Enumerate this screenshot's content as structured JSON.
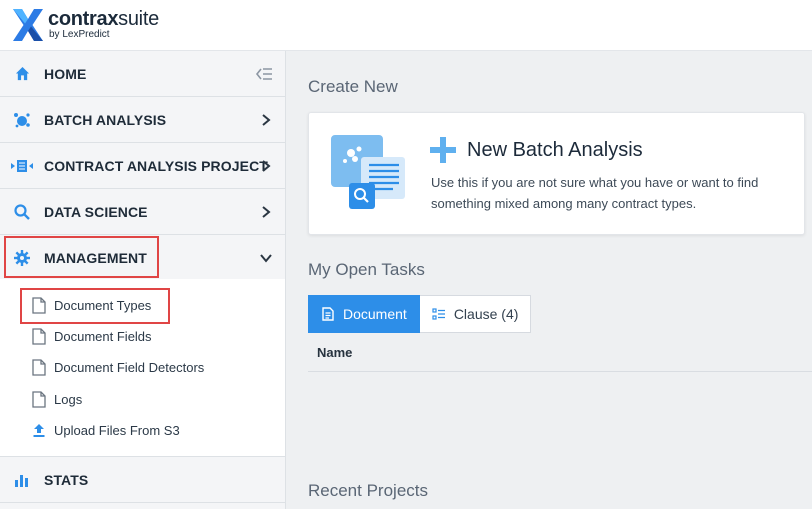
{
  "brand": {
    "name_bold": "contrax",
    "name_light": "suite",
    "byline": "by LexPredict",
    "accent": "#1a8cff"
  },
  "sidebar": {
    "items": [
      {
        "label": "HOME",
        "icon": "home-icon"
      },
      {
        "label": "BATCH ANALYSIS",
        "icon": "batch-icon"
      },
      {
        "label": "CONTRACT ANALYSIS PROJECT",
        "icon": "project-icon"
      },
      {
        "label": "DATA SCIENCE",
        "icon": "search-icon"
      },
      {
        "label": "MANAGEMENT",
        "icon": "gear-icon"
      },
      {
        "label": "STATS",
        "icon": "bar-chart-icon"
      }
    ],
    "management_sub": [
      {
        "label": "Document Types",
        "icon": "document-icon"
      },
      {
        "label": "Document Fields",
        "icon": "document-icon"
      },
      {
        "label": "Document Field Detectors",
        "icon": "document-icon"
      },
      {
        "label": "Logs",
        "icon": "document-icon"
      },
      {
        "label": "Upload Files From S3",
        "icon": "upload-icon"
      }
    ]
  },
  "main": {
    "create_title": "Create New",
    "card": {
      "title": "New Batch Analysis",
      "description": "Use this if you are not sure what you have or want to find something mixed among many contract types."
    },
    "tasks_title": "My Open Tasks",
    "tabs": [
      {
        "label": "Document",
        "active": true
      },
      {
        "label": "Clause (4)",
        "active": false
      }
    ],
    "table": {
      "columns": [
        "Name"
      ]
    },
    "recent_title": "Recent Projects"
  },
  "colors": {
    "primary": "#2d8ee8",
    "highlight": "#e04545"
  }
}
